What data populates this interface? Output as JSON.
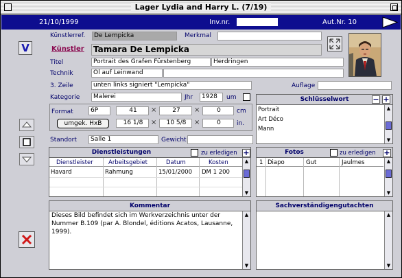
{
  "window": {
    "title": "Lager Lydia and Harry L. (7/19)"
  },
  "header": {
    "date": "21/10/1999",
    "inv_label": "Inv.nr.",
    "inv_value": "",
    "aut_label": "Aut.Nr. 10"
  },
  "fields": {
    "kuenstlerref_label": "Künstlerref.",
    "kuenstlerref_value": "De Lempicka",
    "merkmal_label": "Merkmal",
    "merkmal_value": "",
    "kuenstler_link": "Künstler",
    "kuenstler_value": "Tamara De Lempicka",
    "titel_label": "Titel",
    "titel_value": "Portrait des Grafen Fürstenberg",
    "titel_value2": "Herdringen",
    "technik_label": "Technik",
    "technik_value": "Öl auf Leinwand",
    "zeile3_label": "3. Zeile",
    "zeile3_value": "unten links signiert \"Lempicka\"",
    "auflage_label": "Auflage",
    "auflage_value": "",
    "kategorie_label": "Kategorie",
    "kategorie_value": "Malerei",
    "jhr_label": "Jhr",
    "jhr_value": "1928",
    "um_label": "um",
    "format_label": "Format",
    "format_value": "6P",
    "dim1": "41",
    "dim2": "27",
    "dim3": "0",
    "unit_cm": "cm",
    "umgek_button": "umgek. HxB",
    "dim1_in": "16 1/8",
    "dim2_in": "10 5/8",
    "dim3_in": "0",
    "unit_in": "in.",
    "standort_label": "Standort",
    "standort_value": "Salle 1",
    "gewicht_label": "Gewicht",
    "gewicht_value": ""
  },
  "schluesselwort": {
    "title": "Schlüsselwort",
    "items": [
      "Portrait",
      "Art Déco",
      "Mann"
    ]
  },
  "dienstleistungen": {
    "title": "Dienstleistungen",
    "done_label": "zu erledigen",
    "columns": [
      "Dienstleister",
      "Arbeitsgebiet",
      "Datum",
      "Kosten"
    ],
    "rows": [
      [
        "Havard",
        "Rahmung",
        "15/01/2000",
        "DM 1 200"
      ]
    ]
  },
  "fotos": {
    "title": "Fotos",
    "done_label": "zu erledigen",
    "row": {
      "num": "1",
      "type": "Diapo",
      "quality": "Gut",
      "photographer": "Jaulmes"
    }
  },
  "kommentar": {
    "title": "Kommentar",
    "text": "    Dieses Bild befindet sich im Werkverzeichnis unter der Nummer B.109 (par A. Blondel, éditions Acatos, Lausanne, 1999)."
  },
  "gutachten": {
    "title": "Sachverständigengutachten"
  },
  "colors": {
    "header_blue": "#0d0d8f",
    "label_blue": "#00006a",
    "link_color": "#8b0a50",
    "delete_red": "#d01818"
  }
}
